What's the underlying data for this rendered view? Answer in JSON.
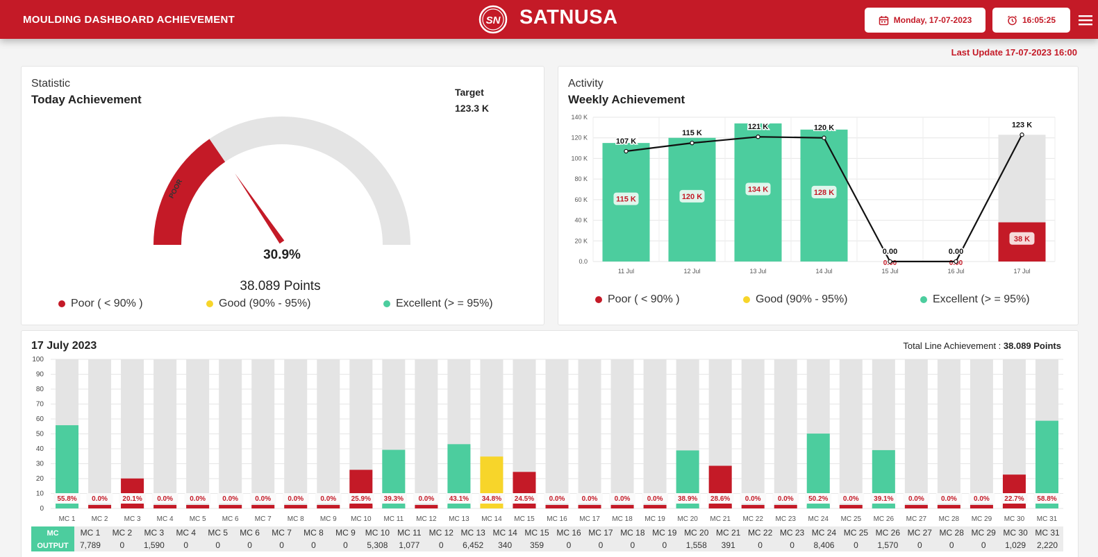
{
  "header": {
    "title": "MOULDING DASHBOARD ACHIEVEMENT",
    "brand": "SATNUSA",
    "logo_text": "SN",
    "date": "Monday, 17-07-2023",
    "time": "16:05:25",
    "calendar_icon": "calendar-icon",
    "clock_icon": "alarm-clock-icon",
    "menu_icon": "hamburger-menu-icon"
  },
  "last_update": "Last Update 17-07-2023 16:00",
  "colors": {
    "brand": "#c41a27",
    "poor": "#c41a27",
    "good": "#f7d52a",
    "excellent": "#4ccd9e",
    "track": "#e4e4e4"
  },
  "statistic": {
    "subtitle": "Statistic",
    "title": "Today Achievement",
    "target_label": "Target",
    "target_value": "123.3 K",
    "gauge_value": 30.9,
    "gauge_label": "30.9%",
    "gauge_band_label": "POOR",
    "points": "38.089 Points"
  },
  "legend": {
    "poor": "Poor ( < 90% )",
    "good": "Good (90% - 95%)",
    "excellent": "Excellent (> = 95%)"
  },
  "activity": {
    "subtitle": "Activity",
    "title": "Weekly Achievement"
  },
  "bottom": {
    "title": "17 July 2023",
    "total_label": "Total Line Achievement : ",
    "total_value": "38.089 Points"
  },
  "chart_data": [
    {
      "type": "bar",
      "title": "Weekly Achievement",
      "categories": [
        "11 Jul",
        "12 Jul",
        "13 Jul",
        "14 Jul",
        "15 Jul",
        "16 Jul",
        "17 Jul"
      ],
      "series": [
        {
          "type": "bar",
          "values": [
            115,
            120,
            134,
            128,
            0,
            0,
            38
          ],
          "data_labels": [
            "115 K",
            "120 K",
            "134 K",
            "128 K",
            "0.00",
            "0.00",
            "38 K"
          ],
          "colors": [
            "excellent",
            "excellent",
            "excellent",
            "excellent",
            "poor",
            "poor",
            "poor"
          ]
        },
        {
          "type": "bar",
          "values": [
            0,
            0,
            0,
            0,
            0,
            0,
            123
          ],
          "note_color": "track"
        },
        {
          "type": "line",
          "values": [
            107,
            115,
            121,
            120,
            0,
            0,
            123
          ],
          "data_labels": [
            "107 K",
            "115 K",
            "121 K",
            "120 K",
            "0.00",
            "0.00",
            "123 K"
          ]
        }
      ],
      "yticks": [
        "0.0",
        "20 K",
        "40 K",
        "60 K",
        "80 K",
        "100 K",
        "120 K",
        "140 K"
      ],
      "ylim": [
        0,
        140
      ],
      "grid": true
    },
    {
      "type": "bar",
      "title": "17 July 2023",
      "categories": [
        "MC 1",
        "MC 2",
        "MC 3",
        "MC 4",
        "MC 5",
        "MC 6",
        "MC 7",
        "MC 8",
        "MC 9",
        "MC 10",
        "MC 11",
        "MC 12",
        "MC 13",
        "MC 14",
        "MC 15",
        "MC 16",
        "MC 17",
        "MC 18",
        "MC 19",
        "MC 20",
        "MC 21",
        "MC 22",
        "MC 23",
        "MC 24",
        "MC 25",
        "MC 26",
        "MC 27",
        "MC 28",
        "MC 29",
        "MC 30",
        "MC 31"
      ],
      "values": [
        55.8,
        0,
        20.1,
        0,
        0,
        0,
        0,
        0,
        0,
        25.9,
        39.3,
        0,
        43.1,
        34.8,
        24.5,
        0,
        0,
        0,
        0,
        38.9,
        28.6,
        0,
        0,
        50.2,
        0,
        39.1,
        0,
        0,
        0,
        22.7,
        58.8
      ],
      "data_labels": [
        "55.8%",
        "0.0%",
        "20.1%",
        "0.0%",
        "0.0%",
        "0.0%",
        "0.0%",
        "0.0%",
        "0.0%",
        "25.9%",
        "39.3%",
        "0.0%",
        "43.1%",
        "34.8%",
        "24.5%",
        "0.0%",
        "0.0%",
        "0.0%",
        "0.0%",
        "38.9%",
        "28.6%",
        "0.0%",
        "0.0%",
        "50.2%",
        "0.0%",
        "39.1%",
        "0.0%",
        "0.0%",
        "0.0%",
        "22.7%",
        "58.8%"
      ],
      "colors": [
        "excellent",
        "poor",
        "poor",
        "poor",
        "poor",
        "poor",
        "poor",
        "poor",
        "poor",
        "poor",
        "excellent",
        "poor",
        "excellent",
        "good",
        "poor",
        "poor",
        "poor",
        "poor",
        "poor",
        "excellent",
        "poor",
        "poor",
        "poor",
        "excellent",
        "poor",
        "excellent",
        "poor",
        "poor",
        "poor",
        "poor",
        "excellent"
      ],
      "yticks": [
        "0",
        "10",
        "20",
        "30",
        "40",
        "50",
        "60",
        "70",
        "80",
        "90",
        "100"
      ],
      "ylim": [
        0,
        100
      ],
      "grid": true
    }
  ],
  "output_table": {
    "header_label": "MC",
    "row_label": "OUTPUT",
    "columns": [
      "MC 1",
      "MC 2",
      "MC 3",
      "MC 4",
      "MC 5",
      "MC 6",
      "MC 7",
      "MC 8",
      "MC 9",
      "MC 10",
      "MC 11",
      "MC 12",
      "MC 13",
      "MC 14",
      "MC 15",
      "MC 16",
      "MC 17",
      "MC 18",
      "MC 19",
      "MC 20",
      "MC 21",
      "MC 22",
      "MC 23",
      "MC 24",
      "MC 25",
      "MC 26",
      "MC 27",
      "MC 28",
      "MC 29",
      "MC 30",
      "MC 31"
    ],
    "values": [
      "7,789",
      "0",
      "1,590",
      "0",
      "0",
      "0",
      "0",
      "0",
      "0",
      "5,308",
      "1,077",
      "0",
      "6,452",
      "340",
      "359",
      "0",
      "0",
      "0",
      "0",
      "1,558",
      "391",
      "0",
      "0",
      "8,406",
      "0",
      "1,570",
      "0",
      "0",
      "0",
      "1,029",
      "2,220"
    ]
  }
}
